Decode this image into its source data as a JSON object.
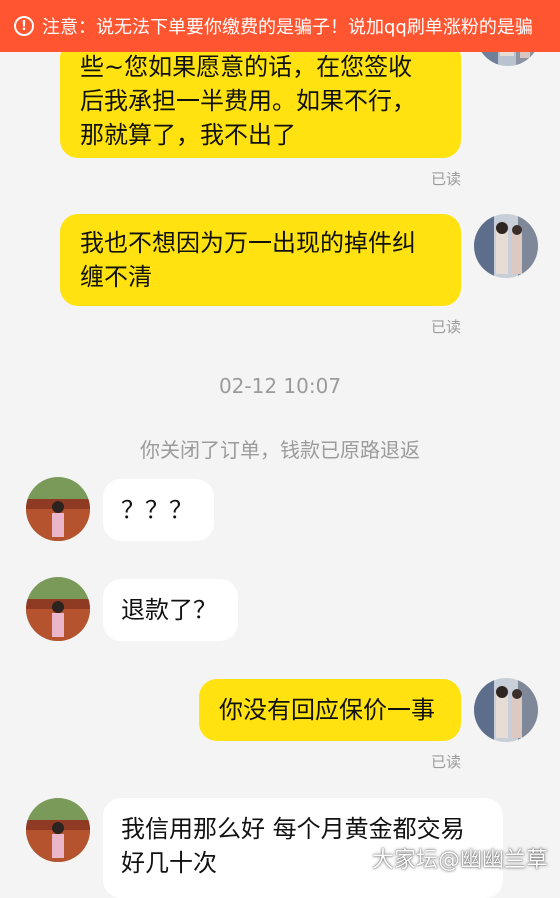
{
  "notice": {
    "icon": "warning-circle-icon",
    "text": "注意：说无法下单要你缴费的是骗子！说加qq刷单涨粉的是骗"
  },
  "messages": [
    {
      "direction": "sent",
      "text": "些~您如果愿意的话，在您签收\n后我承担一半费用。如果不行，\n那就算了，我不出了",
      "status": "已读"
    },
    {
      "direction": "sent",
      "text": "我也不想因为万一出现的掉件纠\n缠不清",
      "status": "已读"
    },
    {
      "direction": "recv",
      "text": "？？？"
    },
    {
      "direction": "recv",
      "text": "退款了？"
    },
    {
      "direction": "sent",
      "text": "你没有回应保价一事",
      "status": "已读"
    },
    {
      "direction": "recv",
      "text": "我信用那么好 每个月黄金都交易\n好几十次"
    }
  ],
  "timestamp": "02-12 10:07",
  "system_message": "你关闭了订单，钱款已原路退返",
  "watermark": "大家坛@幽幽兰草",
  "colors": {
    "sent_bubble": "#ffe20f",
    "recv_bubble": "#ffffff",
    "notice_bg": "#ff5530",
    "background": "#f4f4f4"
  }
}
